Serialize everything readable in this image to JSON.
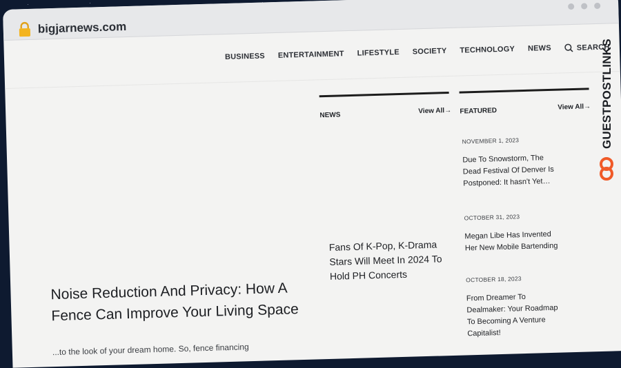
{
  "browser": {
    "url": "bigjarnews.com"
  },
  "nav": {
    "items": [
      "BUSINESS",
      "ENTERTAINMENT",
      "LIFESTYLE",
      "SOCIETY",
      "TECHNOLOGY",
      "NEWS"
    ],
    "search_label": "SEARCH"
  },
  "hero": {
    "title": "Noise Reduction And Privacy: How A Fence Can Improve Your Living Space",
    "excerpt": "...to the look of your dream home. So, fence financing"
  },
  "news": {
    "heading": "NEWS",
    "view_all": "View All",
    "article_title": "Fans Of K-Pop, K-Drama Stars Will Meet In 2024 To Hold PH Concerts"
  },
  "featured": {
    "heading": "FEATURED",
    "view_all": "View All",
    "items": [
      {
        "date": "NOVEMBER 1, 2023",
        "title": "Due To Snowstorm, The Dead Festival Of Denver Is Postponed: It hasn't Yet…"
      },
      {
        "date": "OCTOBER 31, 2023",
        "title": "Megan Libe Has Invented Her New Mobile Bartending"
      },
      {
        "date": "OCTOBER 18, 2023",
        "title": "From Dreamer To Dealmaker: Your Roadmap To Becoming A Venture Capitalist!"
      }
    ]
  },
  "watermark": {
    "text": "GUESTPOSTLINKS",
    "accent": "#f05a28"
  },
  "icons": {
    "lock": "lock-icon",
    "search": "search-icon",
    "arrow": "arrow-right-icon"
  }
}
